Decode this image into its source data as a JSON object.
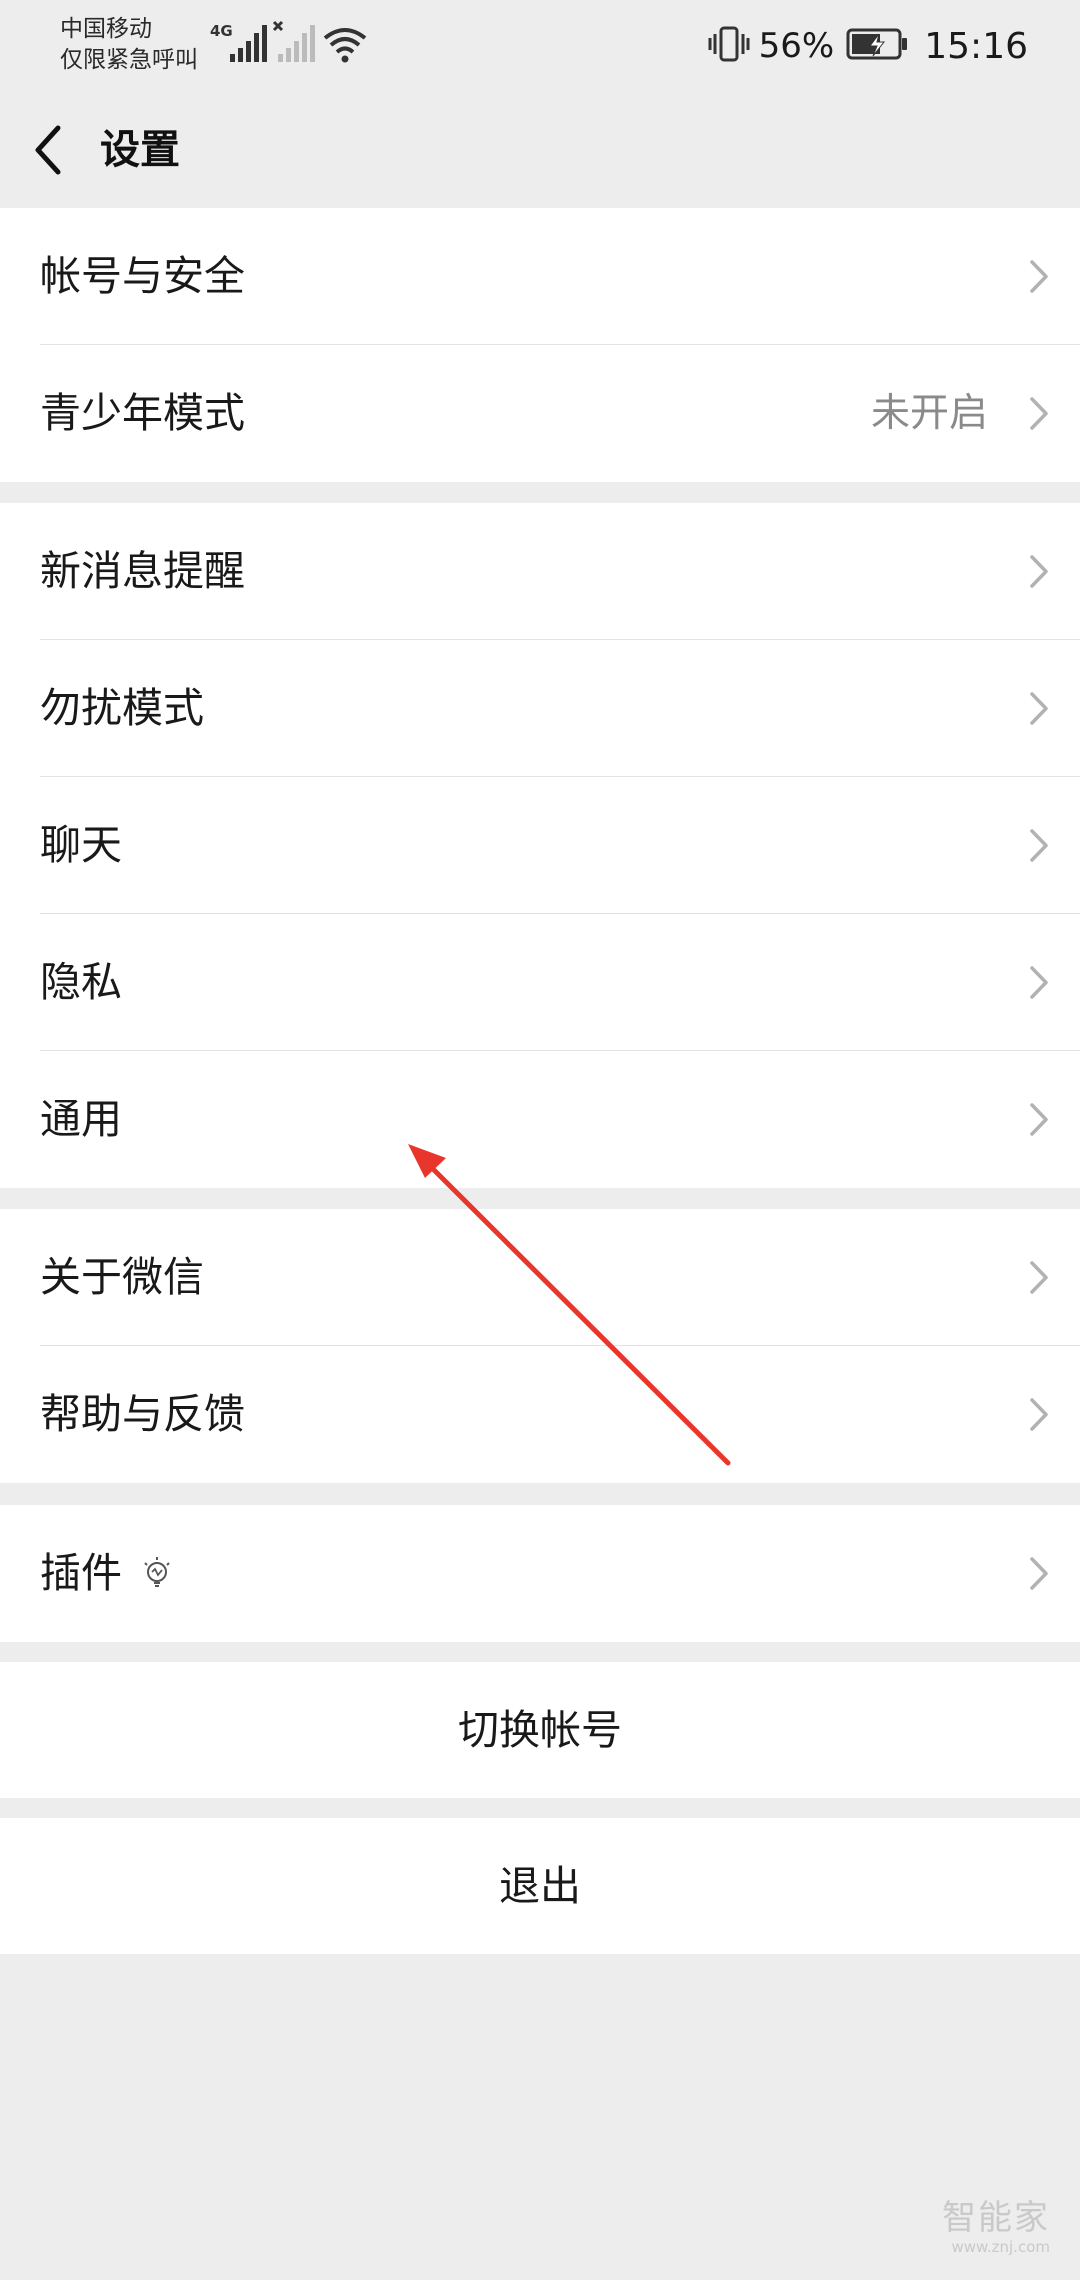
{
  "status_bar": {
    "carrier_line1": "中国移动",
    "carrier_line2": "仅限紧急呼叫",
    "network": "4G",
    "battery_percent": "56%",
    "time": "15:16",
    "icons": [
      "signal-icon",
      "signal-disabled-icon",
      "wifi-icon",
      "vibrate-icon",
      "battery-charging-icon"
    ]
  },
  "header": {
    "title": "设置"
  },
  "groups": {
    "account": [
      {
        "label": "帐号与安全",
        "value": ""
      },
      {
        "label": "青少年模式",
        "value": "未开启"
      }
    ],
    "general": [
      {
        "label": "新消息提醒"
      },
      {
        "label": "勿扰模式"
      },
      {
        "label": "聊天"
      },
      {
        "label": "隐私"
      },
      {
        "label": "通用"
      }
    ],
    "about": [
      {
        "label": "关于微信"
      },
      {
        "label": "帮助与反馈"
      }
    ],
    "plugins": [
      {
        "label": "插件"
      }
    ]
  },
  "actions": {
    "switch_account": "切换帐号",
    "logout": "退出"
  },
  "watermark": {
    "main": "智能家",
    "sub": "www.znj.com"
  },
  "colors": {
    "page_background": "#ededed",
    "row_background": "#ffffff",
    "secondary_text": "#8a8a8a",
    "annotation_arrow": "#e8362c"
  }
}
